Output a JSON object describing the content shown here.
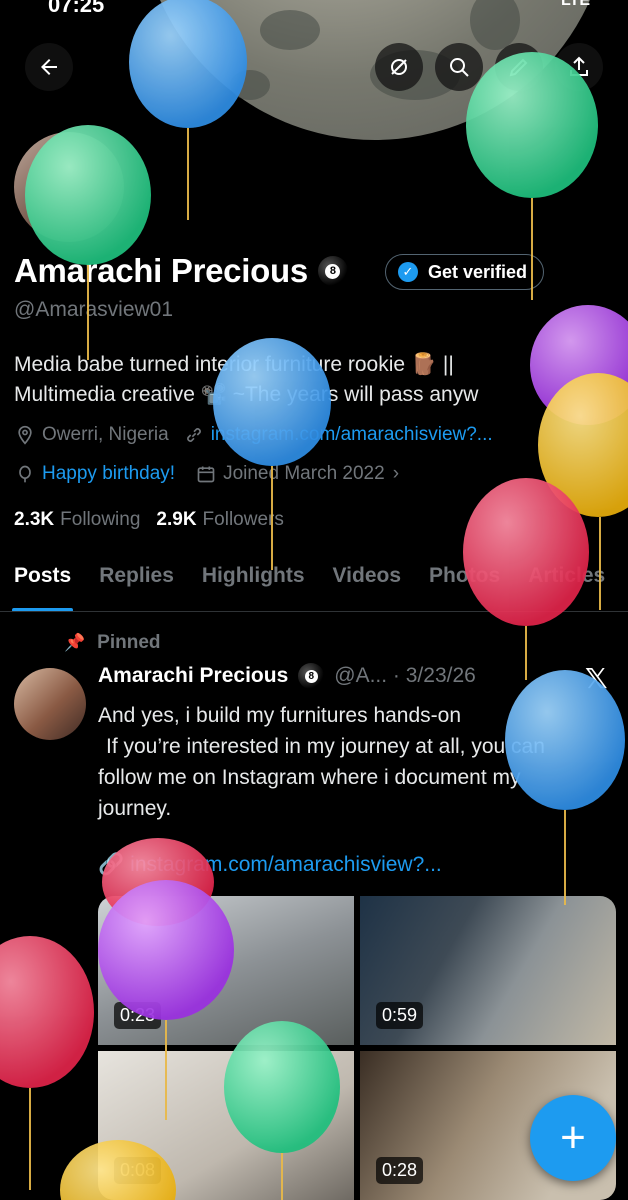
{
  "status_bar": {
    "time": "07:25",
    "network": "LTE"
  },
  "profile": {
    "name": "Amarachi Precious",
    "handle": "@Amarasview01",
    "get_verified_label": "Get verified",
    "bio_line1": "Media babe turned interior furniture rookie 🪵 ||",
    "bio_line2": "Multimedia creative 📽️ ~The years will pass anyw",
    "location": "Owerri, Nigeria",
    "website": "instagram.com/amarachisview?...",
    "birthday": "Happy birthday!",
    "joined": "Joined March 2022",
    "following_count": "2.3K",
    "following_label": "Following",
    "followers_count": "2.9K",
    "followers_label": "Followers"
  },
  "tabs": [
    "Posts",
    "Replies",
    "Highlights",
    "Videos",
    "Photos",
    "Articles"
  ],
  "post": {
    "pinned_label": "Pinned",
    "author": "Amarachi Precious",
    "meta": "@A... · 3/23/26",
    "text_line1": "And yes, i build my furnitures hands-on",
    "text_line2": "If you’re interested in my journey at all, you can",
    "text_line3": "follow me on Instagram where i document my",
    "text_line4": "journey.",
    "link": "instagram.com/amarachisview?...",
    "videos": [
      "0:23",
      "0:59",
      "0:08",
      "0:28"
    ]
  },
  "icons": {
    "back": "back-arrow-icon",
    "grok": "grok-icon",
    "search": "search-icon",
    "edit": "edit-icon",
    "share": "share-icon",
    "compose": "plus-icon"
  },
  "colors": {
    "accent": "#1d9bf0",
    "background": "#000000",
    "secondary_text": "#71767b"
  }
}
